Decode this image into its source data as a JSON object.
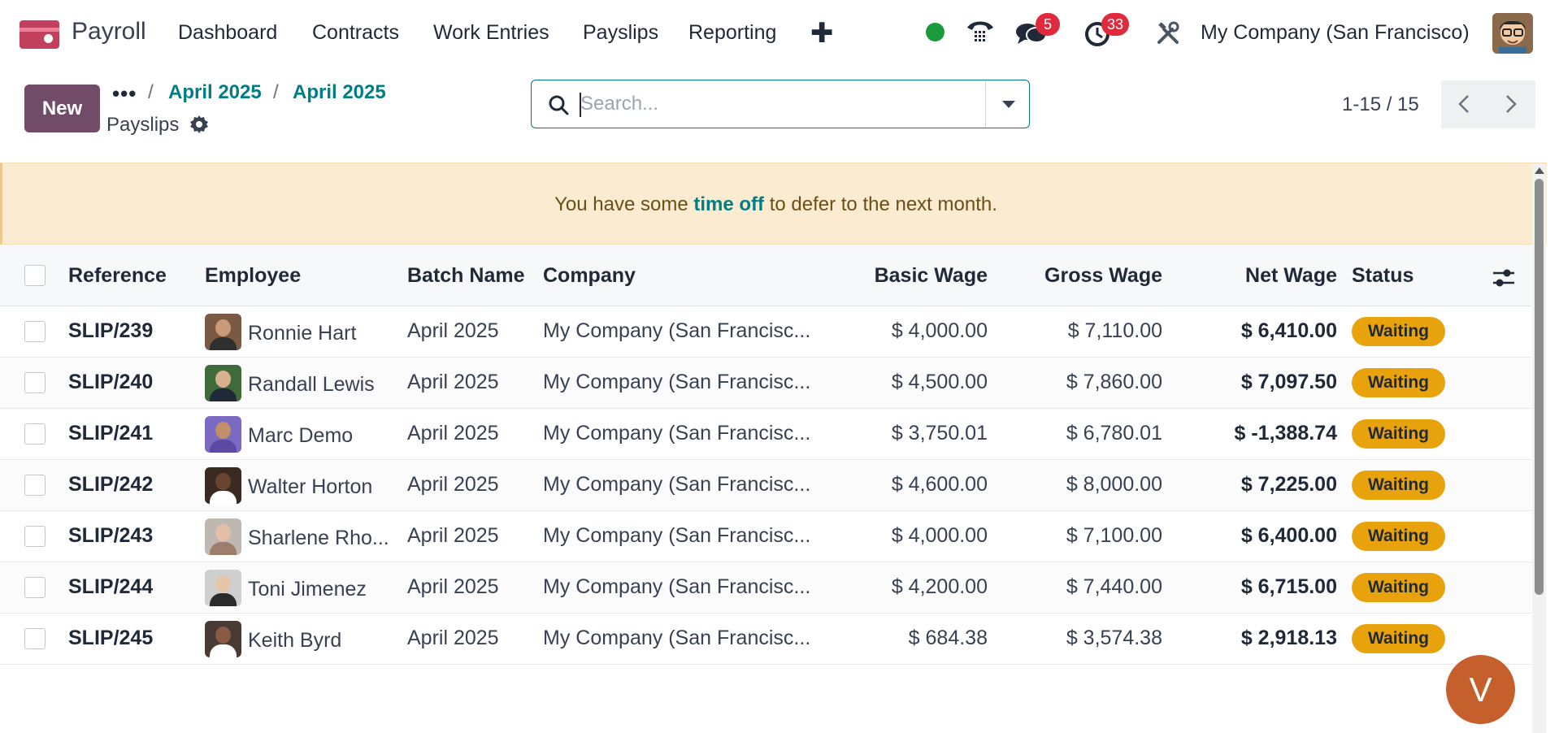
{
  "app": {
    "name": "Payroll",
    "brand_color": "#714b67",
    "accent_color": "#017e84"
  },
  "navbar": {
    "menu": [
      "Dashboard",
      "Contracts",
      "Work Entries",
      "Payslips",
      "Reporting"
    ],
    "add_icon": "plus-icon",
    "messages_badge": "5",
    "activities_badge": "33",
    "company": "My Company (San Francisco)"
  },
  "control": {
    "new_label": "New",
    "more_label": "•••",
    "breadcrumb": [
      "April 2025",
      "April 2025"
    ],
    "separator": "/",
    "current": "Payslips",
    "search_placeholder": "Search...",
    "pager": "1-15 / 15"
  },
  "alert": {
    "before": "You have some ",
    "link": "time off",
    "after": " to defer to the next month."
  },
  "table": {
    "columns": [
      "Reference",
      "Employee",
      "Batch Name",
      "Company",
      "Basic Wage",
      "Gross Wage",
      "Net Wage",
      "Status"
    ],
    "rows": [
      {
        "ref": "SLIP/239",
        "employee": "Ronnie Hart",
        "batch": "April 2025",
        "company": "My Company (San Francisc...",
        "basic": "$ 4,000.00",
        "gross": "$ 7,110.00",
        "net": "$ 6,410.00",
        "status": "Waiting"
      },
      {
        "ref": "SLIP/240",
        "employee": "Randall Lewis",
        "batch": "April 2025",
        "company": "My Company (San Francisc...",
        "basic": "$ 4,500.00",
        "gross": "$ 7,860.00",
        "net": "$ 7,097.50",
        "status": "Waiting"
      },
      {
        "ref": "SLIP/241",
        "employee": "Marc Demo",
        "batch": "April 2025",
        "company": "My Company (San Francisc...",
        "basic": "$ 3,750.01",
        "gross": "$ 6,780.01",
        "net": "$ -1,388.74",
        "status": "Waiting"
      },
      {
        "ref": "SLIP/242",
        "employee": "Walter Horton",
        "batch": "April 2025",
        "company": "My Company (San Francisc...",
        "basic": "$ 4,600.00",
        "gross": "$ 8,000.00",
        "net": "$ 7,225.00",
        "status": "Waiting"
      },
      {
        "ref": "SLIP/243",
        "employee": "Sharlene Rho...",
        "batch": "April 2025",
        "company": "My Company (San Francisc...",
        "basic": "$ 4,000.00",
        "gross": "$ 7,100.00",
        "net": "$ 6,400.00",
        "status": "Waiting"
      },
      {
        "ref": "SLIP/244",
        "employee": "Toni Jimenez",
        "batch": "April 2025",
        "company": "My Company (San Francisc...",
        "basic": "$ 4,200.00",
        "gross": "$ 7,440.00",
        "net": "$ 6,715.00",
        "status": "Waiting"
      },
      {
        "ref": "SLIP/245",
        "employee": "Keith Byrd",
        "batch": "April 2025",
        "company": "My Company (San Francisc...",
        "basic": "$ 684.38",
        "gross": "$ 3,574.38",
        "net": "$ 2,918.13",
        "status": "Waiting"
      }
    ]
  },
  "status_color": "#e8a20c",
  "chat_bubble": "V"
}
